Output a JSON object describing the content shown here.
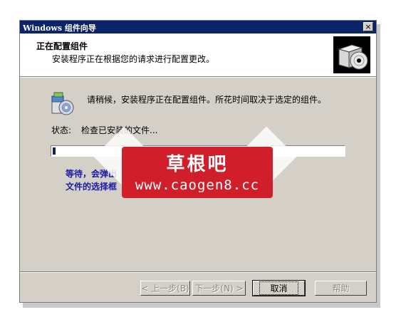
{
  "window": {
    "title": "Windows 组件向导",
    "close_label": "×"
  },
  "header": {
    "title": "正在配置组件",
    "subtitle": "安装程序正在根据您的请求进行配置更改。"
  },
  "main": {
    "message": "请稍候，安装程序正在配置组件。所花时间取决于选定的组件。",
    "status_label": "状态:",
    "status_value": "检查已安装的文件...",
    "progress_fraction": 0.01,
    "wait_text": "等待，会弹出\n文件的选择框"
  },
  "buttons": {
    "back": "< 上一步(B)",
    "next": "下一步(N) >",
    "cancel": "取消",
    "help": "帮助"
  },
  "watermark": {
    "name": "草根吧",
    "url": "www.caogen8.cc"
  },
  "colors": {
    "titlebar": "#0a246a",
    "wait_text": "#1a1aa6",
    "watermark": "#d01f2a"
  }
}
